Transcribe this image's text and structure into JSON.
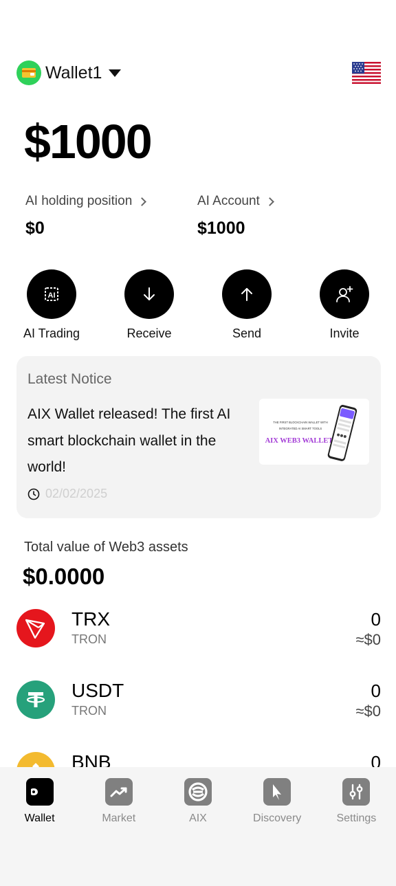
{
  "header": {
    "wallet_name": "Wallet1",
    "wallet_icon": "wallet-card-icon",
    "language_icon": "us-flag-icon"
  },
  "balance": "$1000",
  "stats": [
    {
      "label": "AI holding position",
      "value": "$0"
    },
    {
      "label": "AI Account",
      "value": "$1000"
    }
  ],
  "actions": [
    {
      "label": "AI Trading",
      "icon": "ai-chip-icon"
    },
    {
      "label": "Receive",
      "icon": "arrow-down-icon"
    },
    {
      "label": "Send",
      "icon": "arrow-up-icon"
    },
    {
      "label": "Invite",
      "icon": "add-user-icon"
    }
  ],
  "notice": {
    "title": "Latest Notice",
    "text": "AIX Wallet released! The first AI smart blockchain wallet in the world!",
    "date": "02/02/2025",
    "thumb_line1": "THE FIRST BLOCKCHAIN WALLET WITH",
    "thumb_line2": "INTEGRATED AI SMART TOOLS",
    "thumb_title": "AIX WEB3 WALLET"
  },
  "total": {
    "label": "Total value of Web3 assets",
    "value": "$0.0000"
  },
  "assets": [
    {
      "symbol": "TRX",
      "chain": "TRON",
      "amount": "0",
      "fiat": "≈$0",
      "color": "#e5161d"
    },
    {
      "symbol": "USDT",
      "chain": "TRON",
      "amount": "0",
      "fiat": "≈$0",
      "color": "#26a17b"
    },
    {
      "symbol": "BNB",
      "chain": "",
      "amount": "0",
      "fiat": "",
      "color": "#f3ba2f"
    }
  ],
  "tabs": [
    {
      "label": "Wallet",
      "icon": "wallet-icon",
      "active": true
    },
    {
      "label": "Market",
      "icon": "chart-trend-icon",
      "active": false
    },
    {
      "label": "AIX",
      "icon": "aix-logo-icon",
      "active": false
    },
    {
      "label": "Discovery",
      "icon": "compass-icon",
      "active": false
    },
    {
      "label": "Settings",
      "icon": "sliders-icon",
      "active": false
    }
  ],
  "colors": {
    "accent": "#000000",
    "card_bg": "#f3f3f3",
    "tabbar_bg": "#f5f5f5",
    "wallet_avatar": "#2fd15a"
  }
}
